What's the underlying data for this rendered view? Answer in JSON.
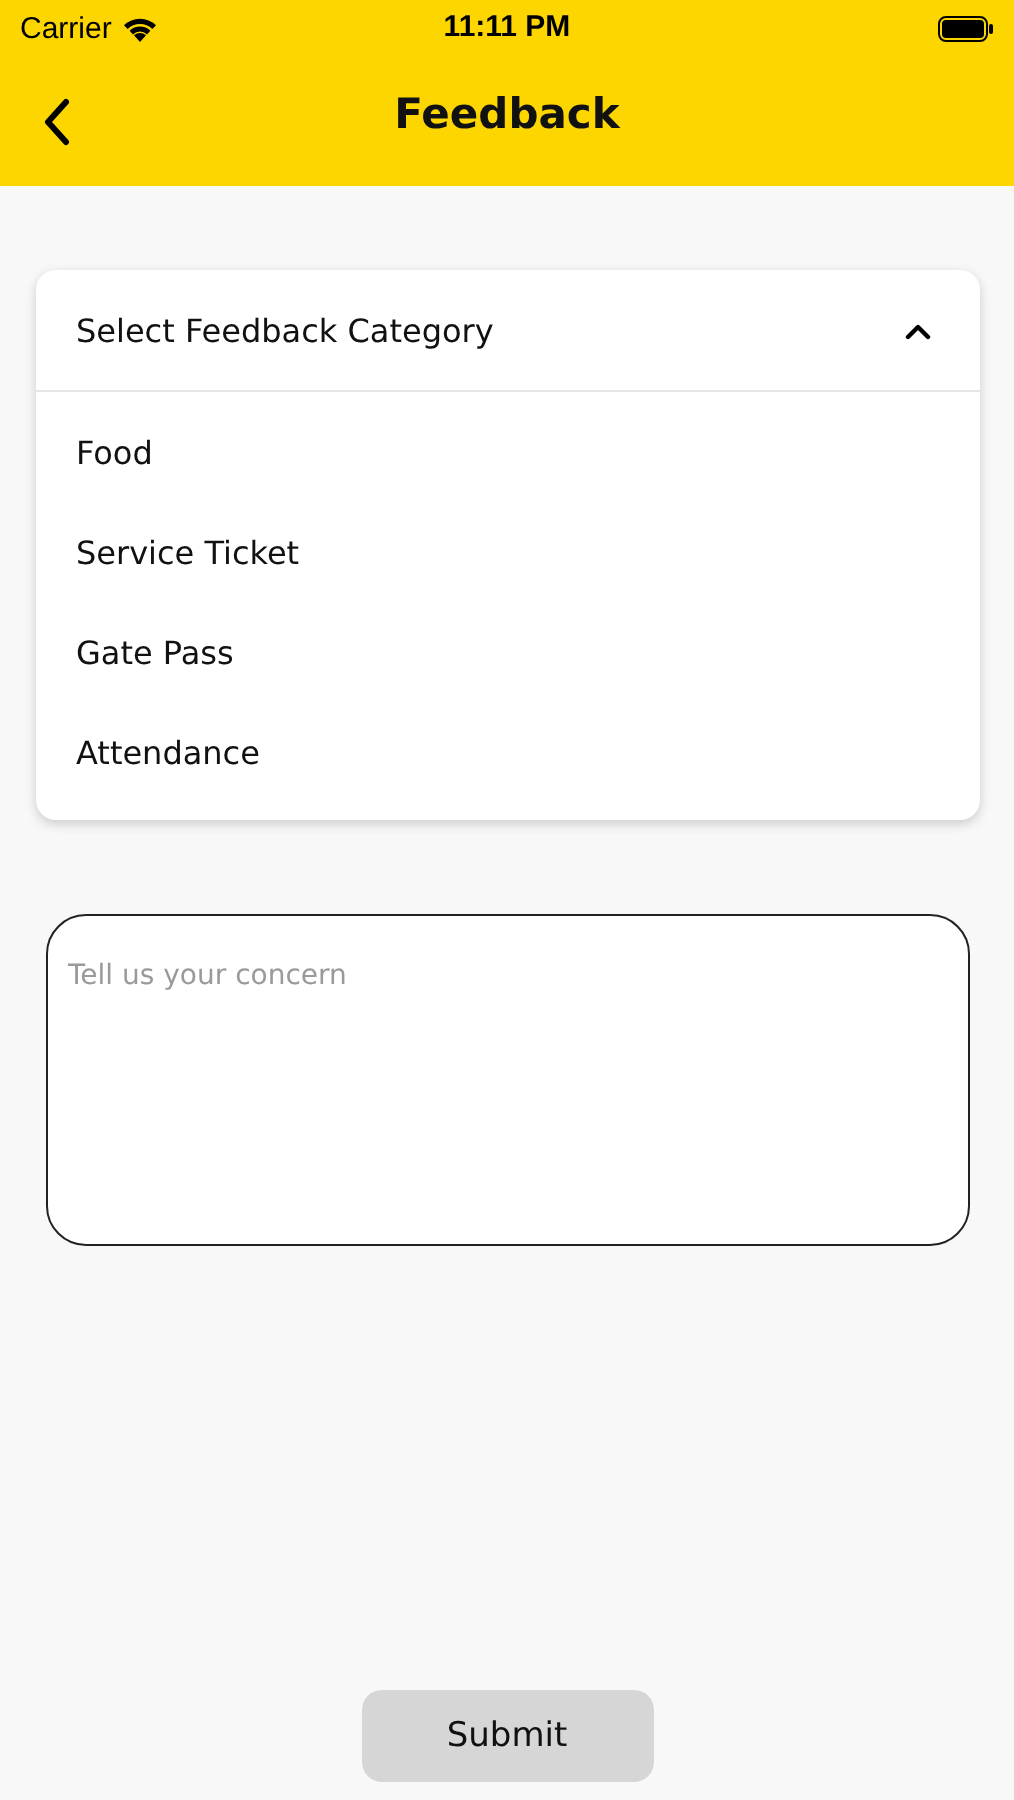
{
  "status_bar": {
    "carrier": "Carrier",
    "time": "11:11 PM"
  },
  "header": {
    "title": "Feedback"
  },
  "dropdown": {
    "label": "Select Feedback Category",
    "expanded": true,
    "options": [
      {
        "label": "Food"
      },
      {
        "label": "Service Ticket"
      },
      {
        "label": "Gate Pass"
      },
      {
        "label": "Attendance"
      }
    ]
  },
  "concern_field": {
    "placeholder": "Tell us your concern"
  },
  "submit_button": {
    "label": "Submit"
  }
}
